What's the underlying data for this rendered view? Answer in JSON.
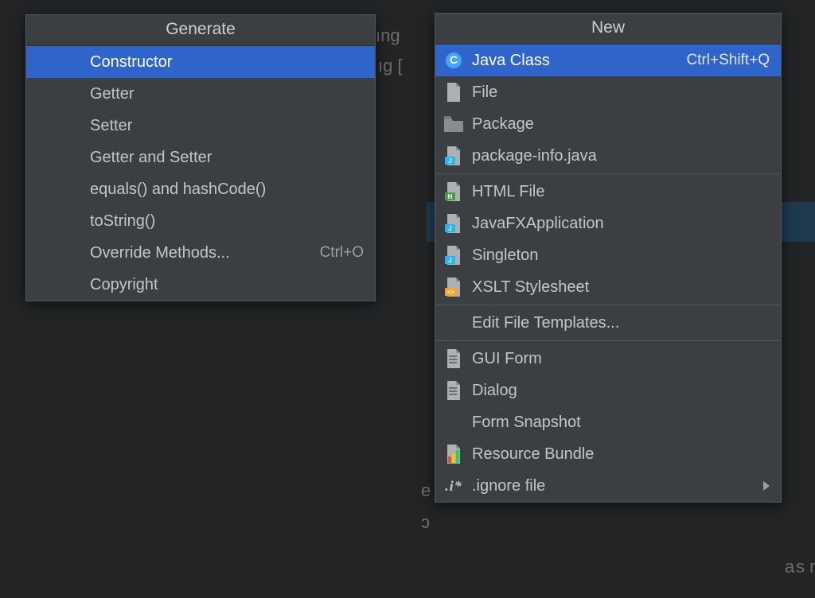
{
  "bg": {
    "a": "ıng",
    "b": "ıg [",
    "c": "e",
    "d": "ɔ",
    "e": "a",
    "f": "s n"
  },
  "generate": {
    "title": "Generate",
    "items": [
      {
        "label": "Constructor",
        "selected": true
      },
      {
        "label": "Getter"
      },
      {
        "label": "Setter"
      },
      {
        "label": "Getter and Setter"
      },
      {
        "label": "equals() and hashCode()"
      },
      {
        "label": "toString()"
      },
      {
        "label": "Override Methods...",
        "shortcut": "Ctrl+O"
      },
      {
        "label": "Copyright"
      }
    ]
  },
  "new": {
    "title": "New",
    "items": [
      {
        "icon": "class-c",
        "label": "Java Class",
        "shortcut": "Ctrl+Shift+Q",
        "selected": true
      },
      {
        "icon": "file",
        "label": "File"
      },
      {
        "icon": "folder",
        "label": "Package"
      },
      {
        "icon": "file-j",
        "label": "package-info.java"
      },
      {
        "icon": "file-h",
        "label": "HTML File",
        "sep": true
      },
      {
        "icon": "file-j",
        "label": "JavaFXApplication"
      },
      {
        "icon": "file-j",
        "label": "Singleton"
      },
      {
        "icon": "file-x",
        "label": "XSLT Stylesheet"
      },
      {
        "icon": "",
        "label": "Edit File Templates...",
        "sep": true
      },
      {
        "icon": "file-g",
        "label": "GUI Form",
        "sep": true
      },
      {
        "icon": "file-g",
        "label": "Dialog"
      },
      {
        "icon": "",
        "label": "Form Snapshot"
      },
      {
        "icon": "bundle",
        "label": "Resource Bundle"
      },
      {
        "icon": "ignore",
        "label": ".ignore file",
        "submenu": true
      }
    ]
  }
}
